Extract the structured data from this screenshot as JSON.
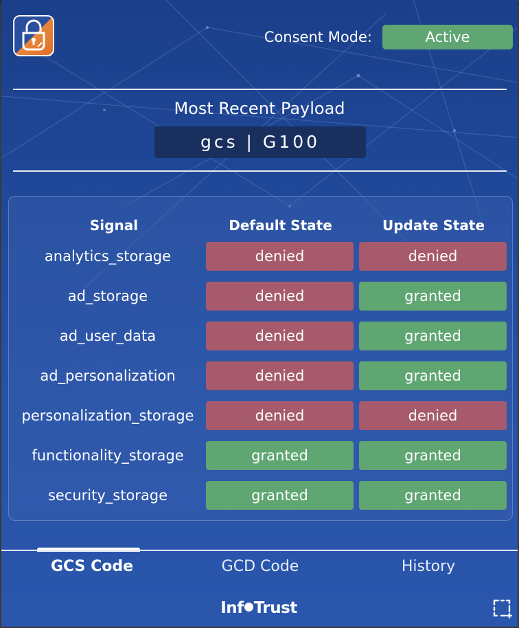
{
  "header": {
    "consent_label": "Consent Mode:",
    "consent_status": "Active",
    "logo_icon": "padlock-shield-icon"
  },
  "payload": {
    "title": "Most Recent Payload",
    "value": "gcs | G100"
  },
  "table": {
    "headers": {
      "signal": "Signal",
      "default_state": "Default State",
      "update_state": "Update State"
    },
    "rows": [
      {
        "signal": "analytics_storage",
        "default": "denied",
        "update": "denied"
      },
      {
        "signal": "ad_storage",
        "default": "denied",
        "update": "granted"
      },
      {
        "signal": "ad_user_data",
        "default": "denied",
        "update": "granted"
      },
      {
        "signal": "ad_personalization",
        "default": "denied",
        "update": "granted"
      },
      {
        "signal": "personalization_storage",
        "default": "denied",
        "update": "denied"
      },
      {
        "signal": "functionality_storage",
        "default": "granted",
        "update": "granted"
      },
      {
        "signal": "security_storage",
        "default": "granted",
        "update": "granted"
      }
    ]
  },
  "tabs": [
    {
      "label": "GCS Code",
      "active": true
    },
    {
      "label": "GCD Code",
      "active": false
    },
    {
      "label": "History",
      "active": false
    }
  ],
  "footer": {
    "brand_left": "Inf",
    "brand_right": "Trust",
    "crop_icon": "crop-selection-icon"
  },
  "colors": {
    "granted": "#5fa672",
    "denied": "#a65a6b",
    "active_badge": "#5fa672",
    "payload_box": "#19305f"
  }
}
